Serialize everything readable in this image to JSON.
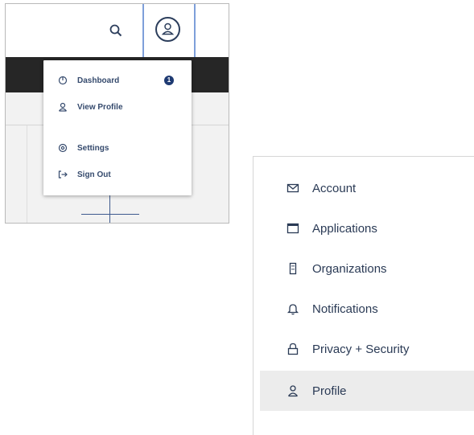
{
  "header_menu": {
    "items": [
      {
        "label": "Dashboard",
        "icon": "dashboard-icon",
        "badge": "1"
      },
      {
        "label": "View Profile",
        "icon": "profile-icon"
      },
      {
        "label": "Settings",
        "icon": "settings-icon"
      },
      {
        "label": "Sign Out",
        "icon": "sign-out-icon"
      }
    ],
    "accent_color": "#7e9fda",
    "badge_color": "#1e3a72"
  },
  "side_nav": {
    "items": [
      {
        "label": "Account",
        "icon": "envelope-icon"
      },
      {
        "label": "Applications",
        "icon": "window-icon"
      },
      {
        "label": "Organizations",
        "icon": "building-icon"
      },
      {
        "label": "Notifications",
        "icon": "bell-icon"
      },
      {
        "label": "Privacy + Security",
        "icon": "lock-icon"
      },
      {
        "label": "Profile",
        "icon": "profile-icon",
        "active": true
      }
    ],
    "active_background": "#ececec"
  }
}
